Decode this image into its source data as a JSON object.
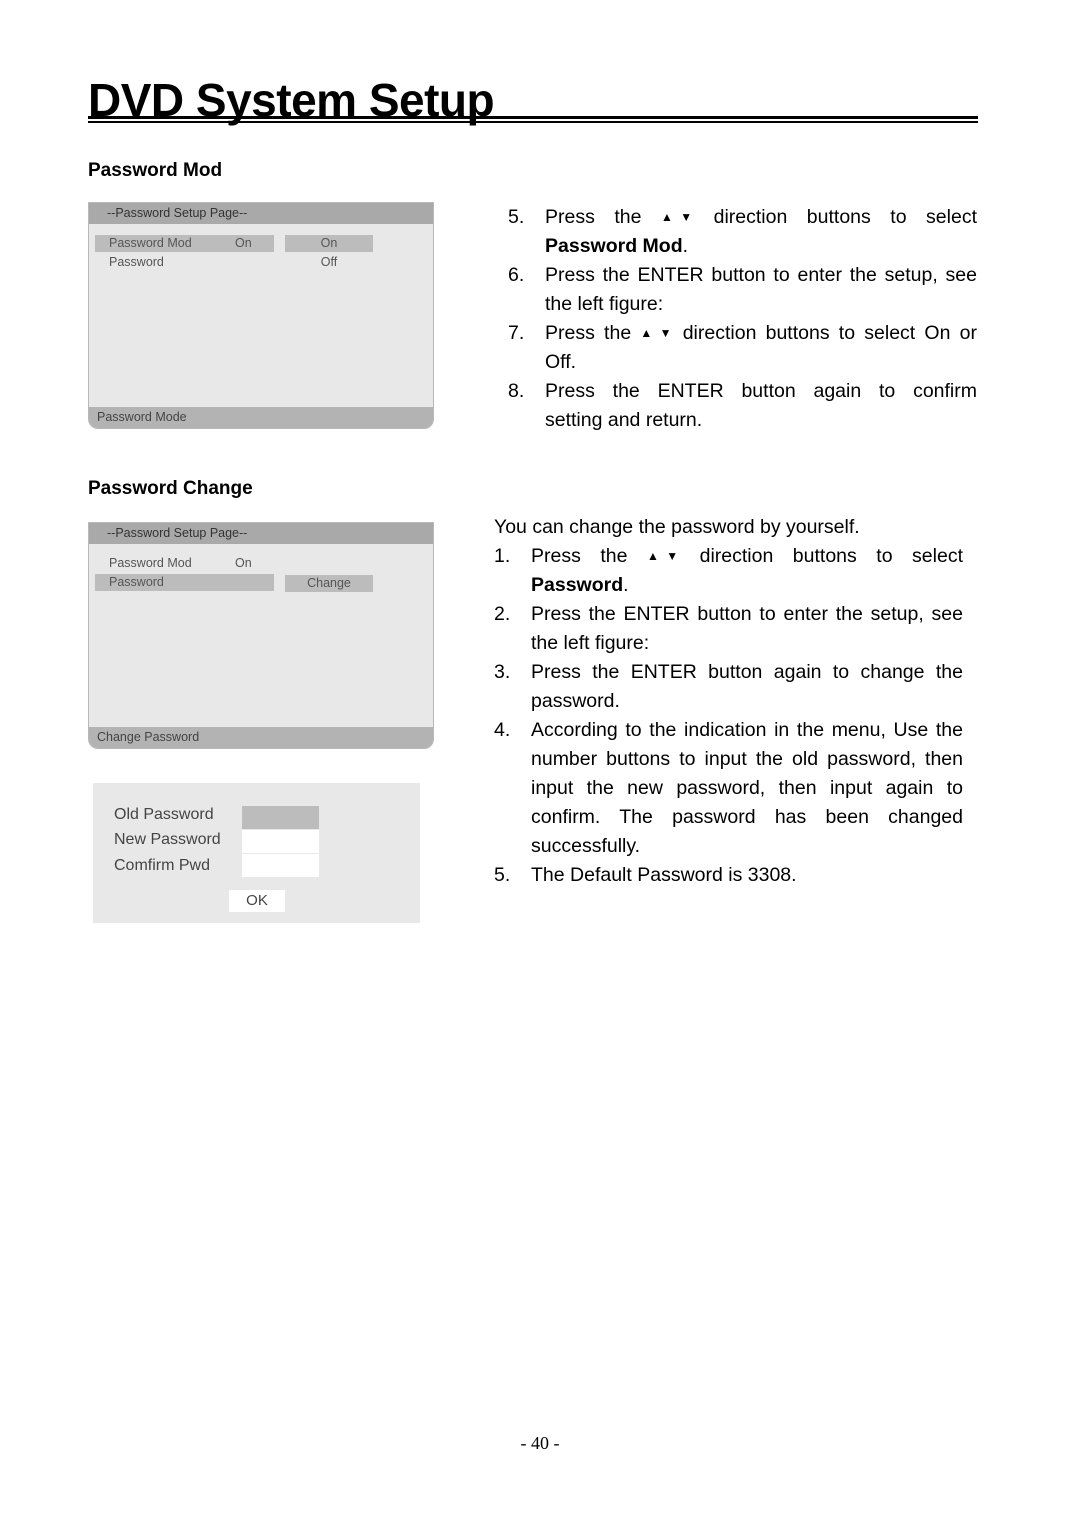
{
  "page": {
    "title": "DVD System Setup",
    "page_number": "- 40 -"
  },
  "sections": {
    "password_mod": {
      "heading": "Password Mod",
      "osd": {
        "header": "--Password Setup Page--",
        "rows": [
          {
            "label": "Password Mod",
            "value": "On",
            "selected": true
          },
          {
            "label": "Password",
            "value": "",
            "selected": false
          }
        ],
        "options": [
          {
            "label": "On",
            "highlight": true
          },
          {
            "label": "Off",
            "highlight": false
          }
        ],
        "footer": "Password Mode"
      },
      "steps": [
        {
          "num": "5.",
          "lines": [
            "Press the",
            "direction buttons to select"
          ],
          "bold": "Password Mod",
          "after_bold": "."
        },
        {
          "num": "6.",
          "line1": "Press the ENTER button to enter the setup, see",
          "line2": "the left figure:"
        },
        {
          "num": "7.",
          "line1a": "Press the",
          "line1b": "direction buttons to select On or",
          "line2": "Off."
        },
        {
          "num": "8.",
          "line1": "Press the ENTER button again to confirm",
          "line2": "setting and return."
        }
      ],
      "arrow_icon": "▲ ▼"
    },
    "password_change": {
      "heading": "Password Change",
      "osd": {
        "header": "--Password Setup Page--",
        "rows": [
          {
            "label": "Password Mod",
            "value": "On",
            "selected": false
          },
          {
            "label": "Password",
            "value": "",
            "selected": true
          }
        ],
        "option": "Change",
        "footer": "Change Password"
      },
      "dialog": {
        "fields": [
          {
            "label": "Old Password",
            "value": "",
            "active": true
          },
          {
            "label": "New Password",
            "value": "",
            "active": false
          },
          {
            "label": "Comfirm Pwd",
            "value": "",
            "active": false
          }
        ],
        "ok_label": "OK"
      },
      "intro": "You can change the password by yourself.",
      "steps": [
        {
          "num": "1.",
          "line1a": "Press the",
          "line1b": "direction buttons to select",
          "bold": "Password",
          "after_bold": "."
        },
        {
          "num": "2.",
          "line1": "Press the ENTER button to enter the setup, see",
          "line2": "the left figure:"
        },
        {
          "num": "3.",
          "line1": "Press the ENTER button again to change the",
          "line2": "password."
        },
        {
          "num": "4.",
          "lines": [
            "According to the indication in the menu, Use the",
            "number buttons to input the old password, then",
            "input the new password, then input again to",
            "confirm. The password has been changed",
            "successfully."
          ]
        },
        {
          "num": "5.",
          "line1": "The Default Password is 3308."
        }
      ]
    }
  }
}
